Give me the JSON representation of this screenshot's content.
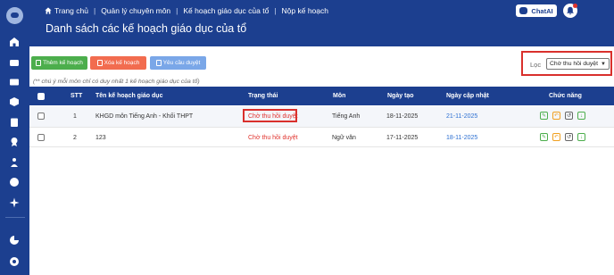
{
  "header": {
    "breadcrumb": [
      "Trang chủ",
      "Quản lý chuyên môn",
      "Kế hoạch giáo dục của tổ",
      "Nộp kế hoạch"
    ],
    "title": "Danh sách các kế hoạch giáo dục của tổ",
    "chatai_label": "ChatAI"
  },
  "sidebar": {
    "items": [
      "home-icon",
      "wallet-icon",
      "card-icon",
      "box-icon",
      "clipboard-icon",
      "award-icon",
      "users-icon",
      "chat-icon",
      "sparkle-icon",
      "pie-chart-icon",
      "settings-icon"
    ]
  },
  "toolbar": {
    "add_label": "Thêm kế hoạch",
    "delete_label": "Xóa kế hoạch",
    "request_label": "Yêu cầu duyệt"
  },
  "filter": {
    "label": "Lọc",
    "selected": "Chờ thu hồi duyệt"
  },
  "note": "(** chú ý mỗi môn chỉ có duy nhất 1 kế hoạch giáo dục của tổ)",
  "table": {
    "headers": {
      "stt": "STT",
      "name": "Tên kế hoạch giáo dục",
      "status": "Trạng thái",
      "subject": "Môn",
      "created": "Ngày tạo",
      "updated": "Ngày cập nhật",
      "actions": "Chức năng"
    },
    "rows": [
      {
        "stt": "1",
        "name": "KHGD môn Tiếng Anh - Khối THPT",
        "status": "Chờ thu hồi duyệt",
        "subject": "Tiếng Anh",
        "created": "18-11-2025",
        "updated": "21-11-2025"
      },
      {
        "stt": "2",
        "name": "123",
        "status": "Chờ thu hồi duyệt",
        "subject": "Ngữ văn",
        "created": "17-11-2025",
        "updated": "18-11-2025"
      }
    ]
  },
  "colors": {
    "primary": "#1c3f8f",
    "add": "#4cae4c",
    "delete": "#f26c4f",
    "request": "#7aa7e8",
    "status_text": "#e0322c",
    "date_link": "#2c6fd1",
    "highlight": "#d9302c"
  }
}
